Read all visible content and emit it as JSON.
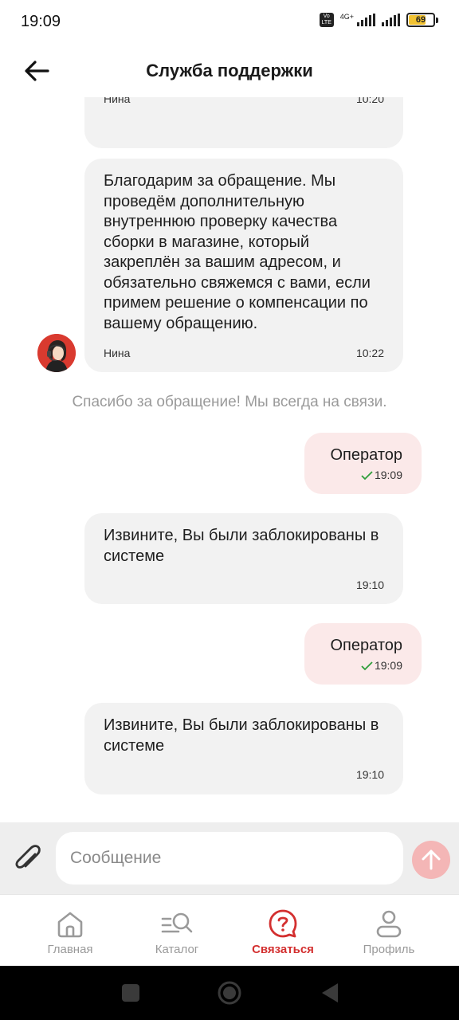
{
  "status_bar": {
    "time": "19:09",
    "network": "4G+",
    "battery": "69"
  },
  "header": {
    "title": "Служба поддержки"
  },
  "messages": [
    {
      "name": "Нина",
      "time": "10:20"
    },
    {
      "text": "Благодарим за обращение. Мы проведём дополнительную внутреннюю проверку качества сборки в магазине, который закреплён за вашим адресом, и обязательно свяжемся с вами, если примем решение о компенсации по вашему обращению.",
      "name": "Нина",
      "time": "10:22"
    },
    {
      "system": "Спасибо за обращение! Мы всегда на связи."
    },
    {
      "text": "Оператор",
      "time": "19:09"
    },
    {
      "text": "Извините, Вы были заблокированы в системе",
      "time": "19:10"
    },
    {
      "text": "Оператор",
      "time": "19:09"
    },
    {
      "text": "Извините, Вы были заблокированы в системе",
      "time": "19:10"
    }
  ],
  "composer": {
    "placeholder": "Сообщение"
  },
  "tabs": [
    {
      "label": "Главная",
      "icon": "home-icon"
    },
    {
      "label": "Каталог",
      "icon": "catalog-search-icon"
    },
    {
      "label": "Связаться",
      "icon": "support-chat-icon",
      "active": true
    },
    {
      "label": "Профиль",
      "icon": "profile-icon"
    }
  ],
  "colors": {
    "accent": "#d32f2f",
    "outgoing_bubble": "#fbe9e9",
    "incoming_bubble": "#f2f2f2",
    "send_button": "#f4b6b6",
    "read_check": "#2e9e3a"
  }
}
